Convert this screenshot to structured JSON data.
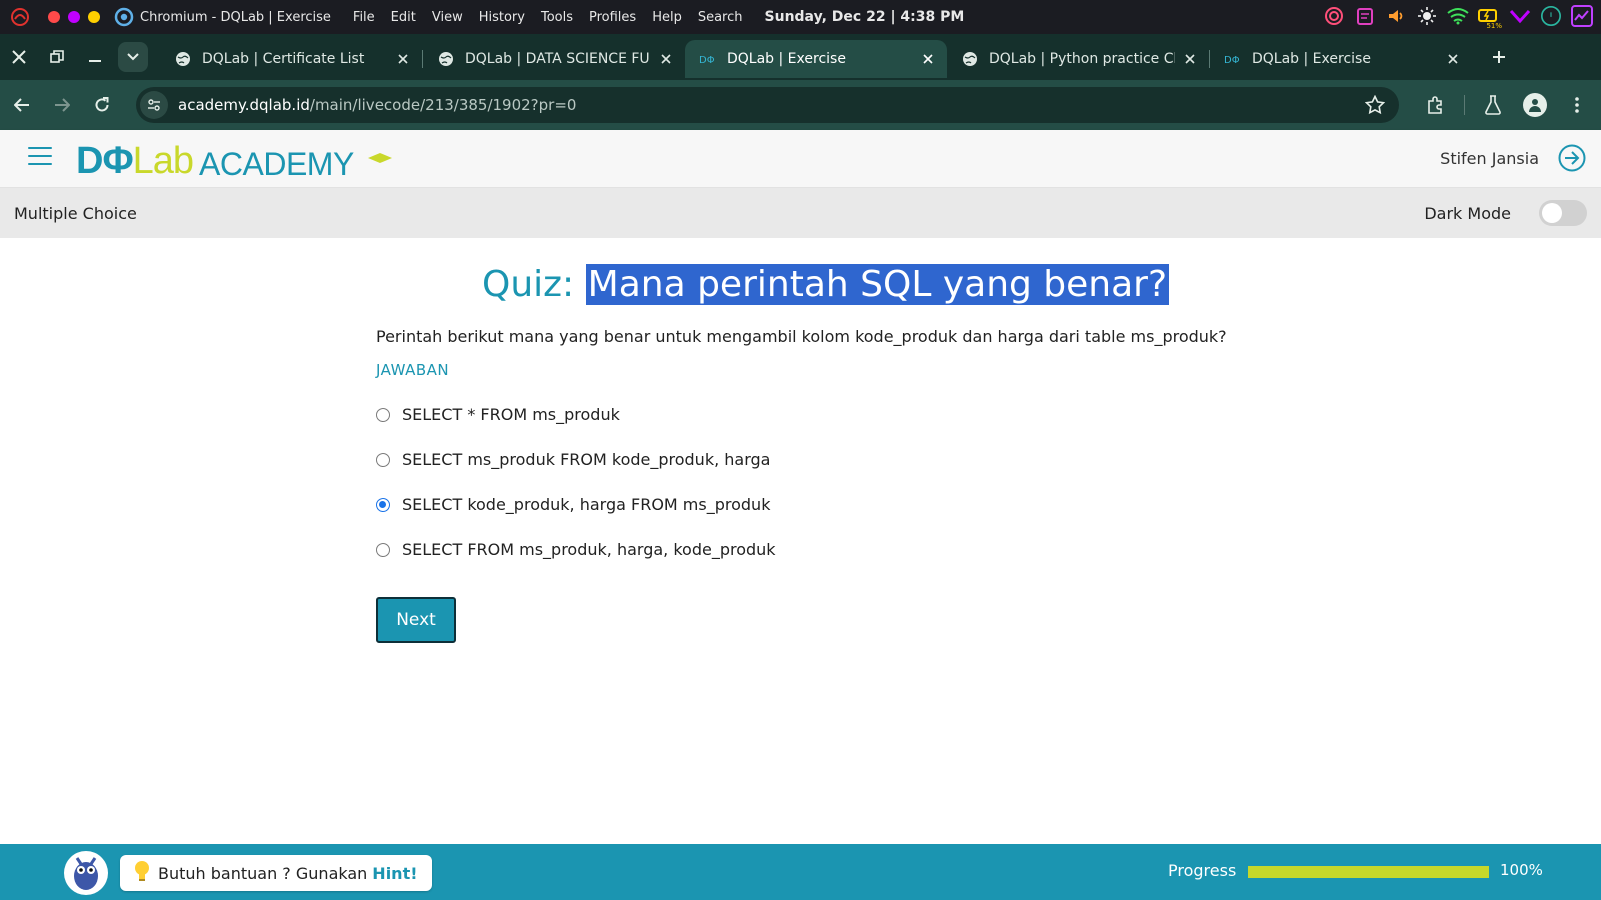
{
  "os_bar": {
    "app_name": "Chromium - DQLab | Exercise",
    "menu": [
      "File",
      "Edit",
      "View",
      "History",
      "Tools",
      "Profiles",
      "Help",
      "Search"
    ],
    "clock": "Sunday, Dec 22 | 4:38 PM",
    "battery_percent": "51%",
    "traffic_colors": [
      "#ff4a4a",
      "#c000ff",
      "#ffd000"
    ]
  },
  "tabs": [
    {
      "title": "DQLab | Certificate List",
      "icon": "globe-icon",
      "active": false
    },
    {
      "title": "DQLab | DATA SCIENCE FUND",
      "icon": "globe-icon",
      "active": false
    },
    {
      "title": "DQLab | Exercise",
      "icon": "dqlab-favicon",
      "active": true
    },
    {
      "title": "DQLab | Python practice Cha",
      "icon": "globe-icon",
      "active": false
    },
    {
      "title": "DQLab | Exercise",
      "icon": "dqlab-favicon",
      "active": false
    }
  ],
  "address_bar": {
    "domain": "academy.dqlab.id",
    "path": "/main/livecode/213/385/1902?pr=0"
  },
  "header": {
    "logo_text": "DQLab",
    "logo_academy": "ACADEMY",
    "user_name": "Stifen Jansia"
  },
  "subheader": {
    "title": "Multiple Choice",
    "dark_mode_label": "Dark Mode",
    "dark_mode_on": false
  },
  "quiz": {
    "prefix": "Quiz:",
    "title": "Mana perintah SQL yang benar?",
    "question": "Perintah berikut mana yang benar untuk mengambil kolom kode_produk dan harga dari table ms_produk?",
    "answer_label": "JAWABAN",
    "options": [
      {
        "label": "SELECT * FROM ms_produk",
        "selected": false
      },
      {
        "label": "SELECT ms_produk FROM kode_produk, harga",
        "selected": false
      },
      {
        "label": "SELECT kode_produk, harga FROM ms_produk",
        "selected": true
      },
      {
        "label": "SELECT FROM ms_produk, harga, kode_produk",
        "selected": false
      }
    ],
    "next_label": "Next"
  },
  "footer": {
    "hint_text": "Butuh bantuan ? Gunakan",
    "hint_word": "Hint!",
    "progress_label": "Progress",
    "progress_value": 1.0,
    "progress_text": "100%"
  },
  "colors": {
    "brand": "#1b95b1",
    "accent_green": "#c6d82a",
    "selection": "#2f66cf"
  }
}
